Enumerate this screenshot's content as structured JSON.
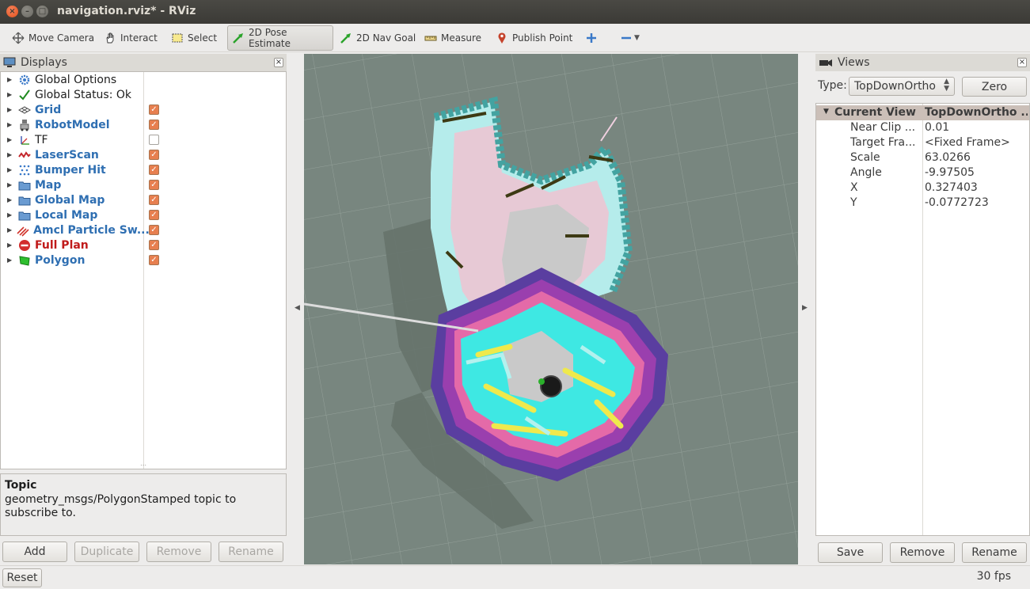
{
  "window": {
    "title": "navigation.rviz* - RViz"
  },
  "toolbar": {
    "tools": [
      {
        "label": "Move Camera",
        "icon": "move-camera-icon"
      },
      {
        "label": "Interact",
        "icon": "hand-icon"
      },
      {
        "label": "Select",
        "icon": "select-box-icon"
      },
      {
        "label": "2D Pose Estimate",
        "icon": "green-arrow-icon",
        "active": true
      },
      {
        "label": "2D Nav Goal",
        "icon": "green-arrow-icon"
      },
      {
        "label": "Measure",
        "icon": "ruler-icon"
      },
      {
        "label": "Publish Point",
        "icon": "map-pin-icon"
      }
    ],
    "add_icon": "plus-icon",
    "remove_icon": "minus-icon"
  },
  "displays": {
    "title": "Displays",
    "items": [
      {
        "label": "Global Options",
        "style": "plain",
        "icon": "gear-icon",
        "checkbox": null
      },
      {
        "label": "Global Status: Ok",
        "style": "plain",
        "icon": "checkmark-icon",
        "checkbox": null
      },
      {
        "label": "Grid",
        "style": "blue",
        "icon": "grid-icon",
        "checkbox": true
      },
      {
        "label": "RobotModel",
        "style": "blue",
        "icon": "robot-icon",
        "checkbox": true
      },
      {
        "label": "TF",
        "style": "plain",
        "icon": "tf-axes-icon",
        "checkbox": false
      },
      {
        "label": "LaserScan",
        "style": "blue",
        "icon": "laser-icon",
        "checkbox": true
      },
      {
        "label": "Bumper Hit",
        "style": "blue",
        "icon": "dots-icon",
        "checkbox": true
      },
      {
        "label": "Map",
        "style": "blue",
        "icon": "folder-icon",
        "checkbox": true
      },
      {
        "label": "Global Map",
        "style": "blue",
        "icon": "folder-icon",
        "checkbox": true
      },
      {
        "label": "Local Map",
        "style": "blue",
        "icon": "folder-icon",
        "checkbox": true
      },
      {
        "label": "Amcl Particle Sw...",
        "style": "blue",
        "icon": "particles-icon",
        "checkbox": true
      },
      {
        "label": "Full Plan",
        "style": "red",
        "icon": "error-icon",
        "checkbox": true
      },
      {
        "label": "Polygon",
        "style": "blue",
        "icon": "polygon-icon",
        "checkbox": true
      }
    ],
    "info_title": "Topic",
    "info_text": "geometry_msgs/PolygonStamped topic to subscribe to.",
    "buttons": {
      "add": "Add",
      "duplicate": "Duplicate",
      "remove": "Remove",
      "rename": "Rename"
    }
  },
  "views": {
    "title": "Views",
    "type_label": "Type:",
    "type_value": "TopDownOrtho",
    "zero_label": "Zero",
    "header": {
      "name": "Current View",
      "value": "TopDownOrtho ..."
    },
    "props": [
      {
        "name": "Near Clip ...",
        "value": "0.01"
      },
      {
        "name": "Target Fra...",
        "value": "<Fixed Frame>"
      },
      {
        "name": "Scale",
        "value": "63.0266"
      },
      {
        "name": "Angle",
        "value": "-9.97505"
      },
      {
        "name": "X",
        "value": "0.327403"
      },
      {
        "name": "Y",
        "value": "-0.0772723"
      }
    ],
    "buttons": {
      "save": "Save",
      "remove": "Remove",
      "rename": "Rename"
    }
  },
  "status": {
    "reset": "Reset",
    "fps": "30 fps"
  }
}
